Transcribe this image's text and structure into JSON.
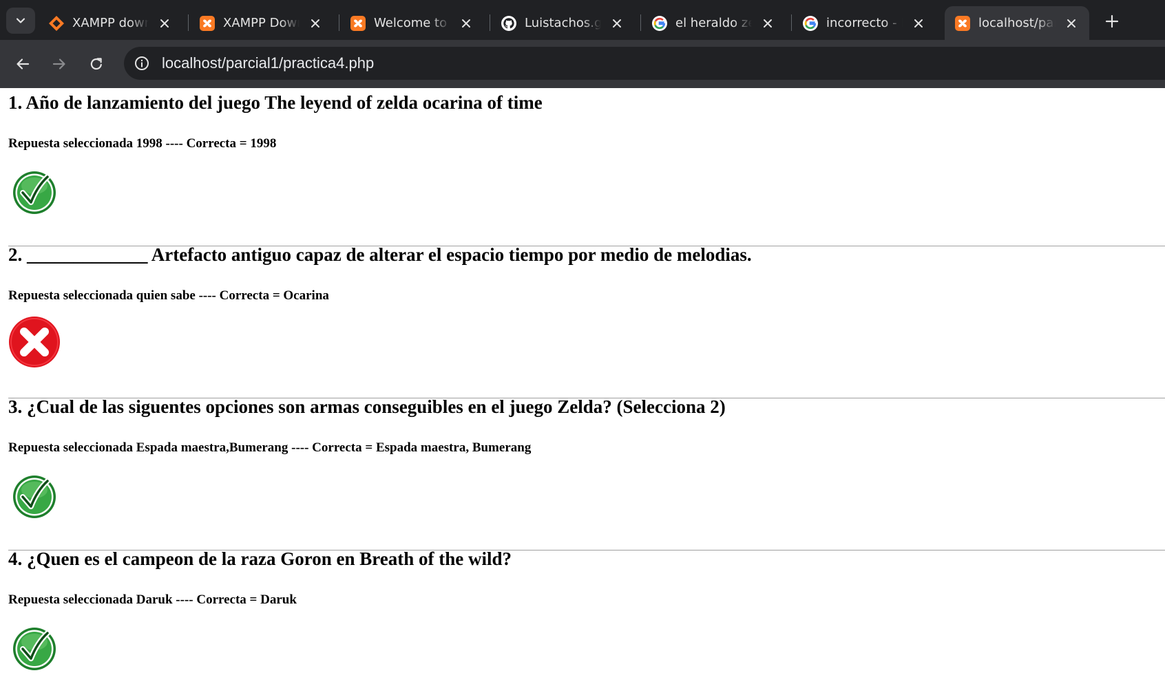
{
  "browser": {
    "tabs": [
      {
        "title": "XAMPP downl",
        "favicon": "xampp-orange-diamond-icon",
        "active": false
      },
      {
        "title": "XAMPP Downl",
        "favicon": "xampp-logo-icon",
        "active": false
      },
      {
        "title": "Welcome to X",
        "favicon": "xampp-logo-icon",
        "active": false
      },
      {
        "title": "Luistachos.git",
        "favicon": "github-icon",
        "active": false
      },
      {
        "title": "el heraldo zeld",
        "favicon": "google-icon",
        "active": false
      },
      {
        "title": "incorrecto - Bu",
        "favicon": "google-icon",
        "active": false
      },
      {
        "title": "localhost/parc",
        "favicon": "xampp-logo-icon",
        "active": true
      }
    ],
    "url": "localhost/parcial1/practica4.php",
    "colors": {
      "tabbar": "#202124",
      "toolbar": "#35363a",
      "xampp_orange": "#fb7a24"
    }
  },
  "quiz": {
    "questions": [
      {
        "heading": "1. Año de lanzamiento del juego The leyend of zelda ocarina of time",
        "result_line": "Repuesta seleccionada 1998 ---- Correcta = 1998",
        "correct": true,
        "result_icon": "green-check-icon"
      },
      {
        "heading": "2. _____________ Artefacto antiguo capaz de alterar el espacio tiempo por medio de melodias.",
        "result_line": "Repuesta seleccionada quien sabe ---- Correcta = Ocarina",
        "correct": false,
        "result_icon": "red-x-icon"
      },
      {
        "heading": "3. ¿Cual de las siguentes opciones son armas conseguibles en el juego Zelda? (Selecciona 2)",
        "result_line": "Repuesta seleccionada Espada maestra,Bumerang ---- Correcta = Espada maestra, Bumerang",
        "correct": true,
        "result_icon": "green-check-icon"
      },
      {
        "heading": "4. ¿Quen es el campeon de la raza Goron en Breath of the wild?",
        "result_line": "Repuesta seleccionada Daruk ---- Correcta = Daruk",
        "correct": true,
        "result_icon": "green-check-icon"
      }
    ],
    "colors": {
      "correct": "#2e9e3a",
      "incorrect": "#e0141e",
      "divider": "#a0a0a0"
    }
  }
}
